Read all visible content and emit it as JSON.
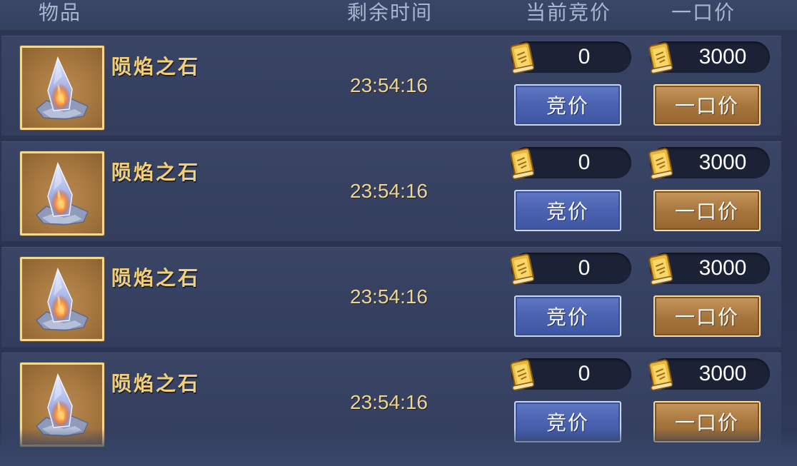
{
  "header": {
    "item": "物品",
    "time_left": "剩余时间",
    "current_bid": "当前竞价",
    "buyout": "一口价"
  },
  "icons": {
    "item": "meteor-flame-stone-icon",
    "currency": "gold-scroll-coupon-icon"
  },
  "colors": {
    "item_name": "#f3cf78",
    "time": "#efd48c",
    "bid_button": "#4a62b0",
    "buyout_button": "#a8763f"
  },
  "rows": [
    {
      "name": "陨焰之石",
      "time": "23:54:16",
      "current_bid": "0",
      "buyout_price": "3000",
      "bid_label": "竞价",
      "buyout_label": "一口价"
    },
    {
      "name": "陨焰之石",
      "time": "23:54:16",
      "current_bid": "0",
      "buyout_price": "3000",
      "bid_label": "竞价",
      "buyout_label": "一口价"
    },
    {
      "name": "陨焰之石",
      "time": "23:54:16",
      "current_bid": "0",
      "buyout_price": "3000",
      "bid_label": "竞价",
      "buyout_label": "一口价"
    },
    {
      "name": "陨焰之石",
      "time": "23:54:16",
      "current_bid": "0",
      "buyout_price": "3000",
      "bid_label": "竞价",
      "buyout_label": "一口价"
    }
  ]
}
